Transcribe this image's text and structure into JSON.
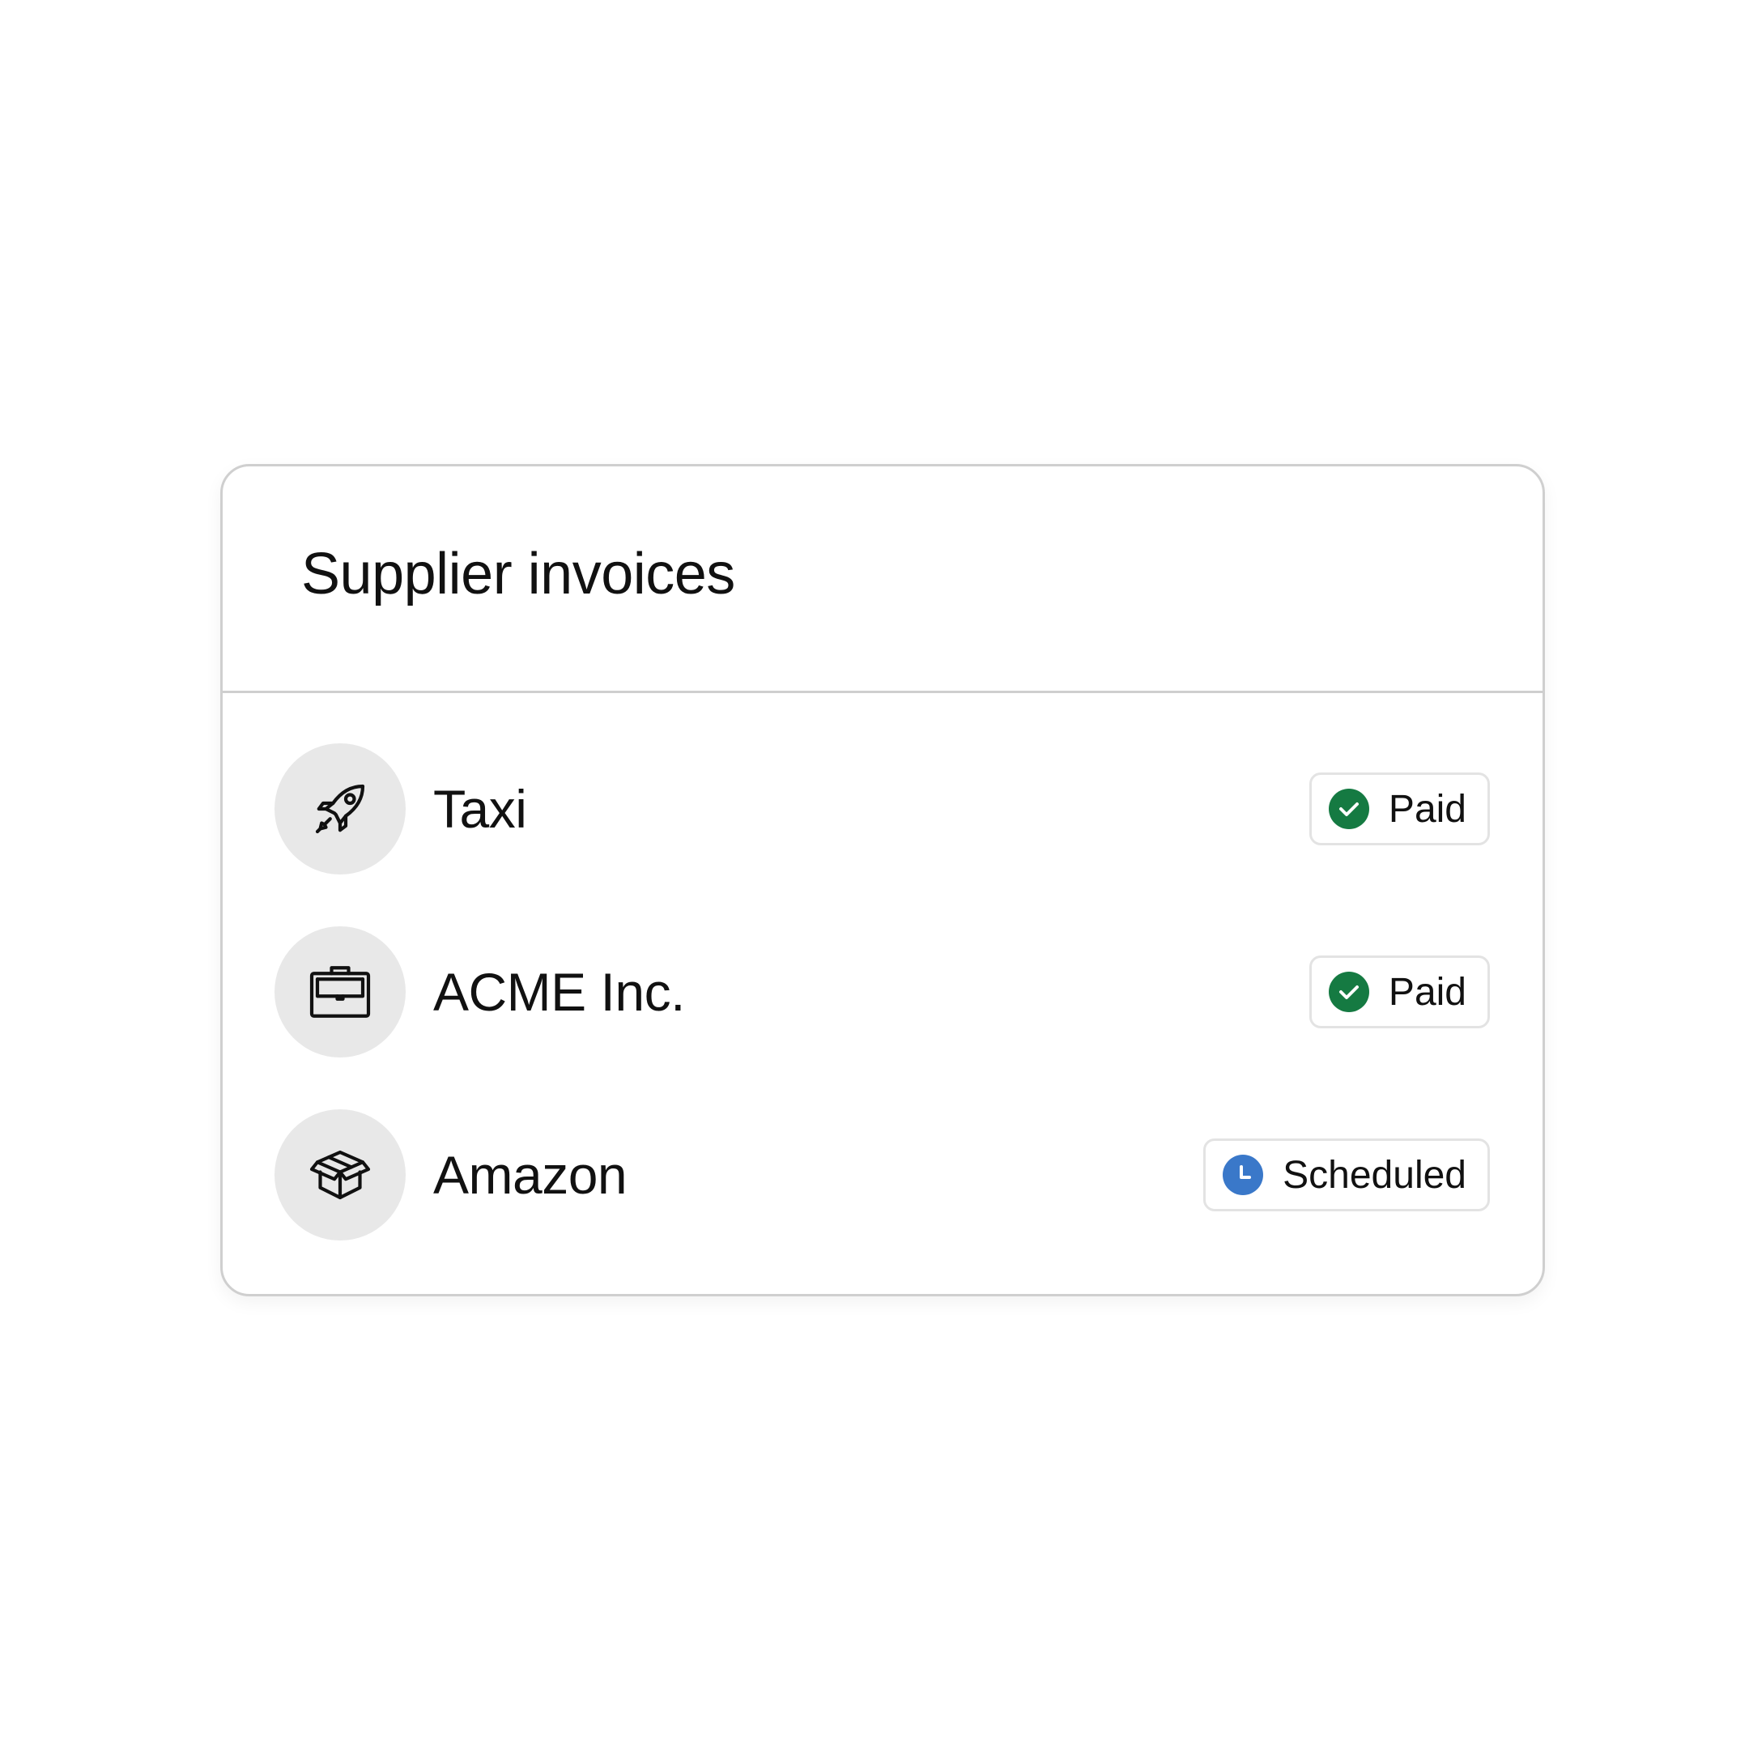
{
  "card": {
    "title": "Supplier invoices"
  },
  "invoices": [
    {
      "name": "Taxi",
      "icon": "rocket-icon",
      "status": "Paid",
      "status_icon": "check-circle-icon",
      "status_color": "#157a42"
    },
    {
      "name": "ACME Inc.",
      "icon": "briefcase-icon",
      "status": "Paid",
      "status_icon": "check-circle-icon",
      "status_color": "#157a42"
    },
    {
      "name": "Amazon",
      "icon": "box-icon",
      "status": "Scheduled",
      "status_icon": "clock-icon",
      "status_color": "#3a78c9"
    }
  ]
}
